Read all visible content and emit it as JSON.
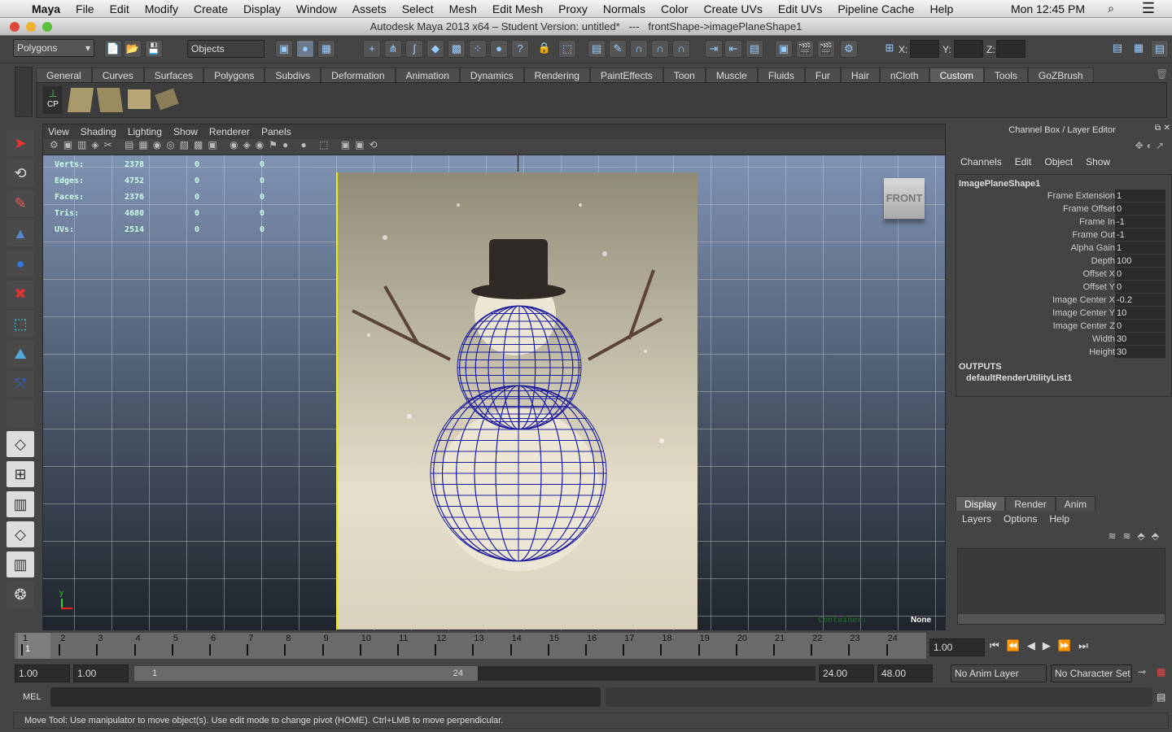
{
  "mac_menu": {
    "apple": "apple-logo",
    "app": "Maya",
    "items": [
      "File",
      "Edit",
      "Modify",
      "Create",
      "Display",
      "Window",
      "Assets",
      "Select",
      "Mesh",
      "Edit Mesh",
      "Proxy",
      "Normals",
      "Color",
      "Create UVs",
      "Edit UVs",
      "Pipeline Cache",
      "Help"
    ],
    "clock": "Mon 12:45 PM"
  },
  "window": {
    "title": "Autodesk Maya 2013 x64 – Student Version: untitled*   ---   frontShape->imagePlaneShape1"
  },
  "status_line": {
    "menu_set": "Polygons",
    "selection_mode": "Objects",
    "x_label": "X:",
    "y_label": "Y:",
    "z_label": "Z:"
  },
  "shelf": {
    "tabs": [
      "General",
      "Curves",
      "Surfaces",
      "Polygons",
      "Subdivs",
      "Deformation",
      "Animation",
      "Dynamics",
      "Rendering",
      "PaintEffects",
      "Toon",
      "Muscle",
      "Fluids",
      "Fur",
      "Hair",
      "nCloth",
      "Custom",
      "Tools",
      "GoZBrush"
    ],
    "active": "Custom",
    "cp_label": "CP"
  },
  "viewport": {
    "menu": [
      "View",
      "Shading",
      "Lighting",
      "Show",
      "Renderer",
      "Panels"
    ],
    "hud": [
      {
        "label": "Verts:",
        "values": [
          "2378",
          "0",
          "0"
        ]
      },
      {
        "label": "Edges:",
        "values": [
          "4752",
          "0",
          "0"
        ]
      },
      {
        "label": "Faces:",
        "values": [
          "2376",
          "0",
          "0"
        ]
      },
      {
        "label": "Tris:",
        "values": [
          "4680",
          "0",
          "0"
        ]
      },
      {
        "label": "UVs:",
        "values": [
          "2514",
          "0",
          "0"
        ]
      }
    ],
    "view_cube": "FRONT",
    "container_label": "Container:",
    "container_value": "None",
    "axis_y": "y"
  },
  "channel_box": {
    "title": "Channel Box / Layer Editor",
    "menu": [
      "Channels",
      "Edit",
      "Object",
      "Show"
    ],
    "node": "ImagePlaneShape1",
    "attributes": [
      {
        "name": "Frame Extension",
        "value": "1"
      },
      {
        "name": "Frame Offset",
        "value": "0"
      },
      {
        "name": "Frame In",
        "value": "-1"
      },
      {
        "name": "Frame Out",
        "value": "-1"
      },
      {
        "name": "Alpha Gain",
        "value": "1"
      },
      {
        "name": "Depth",
        "value": "100"
      },
      {
        "name": "Offset X",
        "value": "0"
      },
      {
        "name": "Offset Y",
        "value": "0"
      },
      {
        "name": "Image Center X",
        "value": "-0.2"
      },
      {
        "name": "Image Center Y",
        "value": "10"
      },
      {
        "name": "Image Center Z",
        "value": "0"
      },
      {
        "name": "Width",
        "value": "30"
      },
      {
        "name": "Height",
        "value": "30"
      }
    ],
    "outputs_label": "OUTPUTS",
    "outputs": [
      "defaultRenderUtilityList1"
    ]
  },
  "layer_editor": {
    "tabs": [
      "Display",
      "Render",
      "Anim"
    ],
    "active": "Display",
    "menu": [
      "Layers",
      "Options",
      "Help"
    ]
  },
  "timeline": {
    "frames": [
      "1",
      "2",
      "3",
      "4",
      "5",
      "6",
      "7",
      "8",
      "9",
      "10",
      "11",
      "12",
      "13",
      "14",
      "15",
      "16",
      "17",
      "18",
      "19",
      "20",
      "21",
      "22",
      "23",
      "24"
    ],
    "current": "1",
    "current_field": "1.00"
  },
  "range": {
    "start": "1.00",
    "playback_start": "1.00",
    "slider_start": "1",
    "slider_end": "24",
    "playback_end": "24.00",
    "end": "48.00",
    "anim_layer": "No Anim Layer",
    "character_set": "No Character Set"
  },
  "command": {
    "label": "MEL"
  },
  "help_line": "Move Tool: Use manipulator to move object(s). Use edit mode to change pivot (HOME).  Ctrl+LMB to move perpendicular.",
  "colors": {
    "wireframe": "#1a1aa0",
    "hud": "#cceeff",
    "container": "#1d5a2a"
  }
}
